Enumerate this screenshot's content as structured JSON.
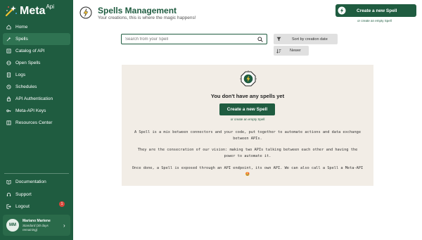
{
  "app": {
    "logo_text": "Meta",
    "logo_sup": "Api"
  },
  "sidebar": {
    "items": [
      {
        "label": "Home",
        "icon": "home-icon"
      },
      {
        "label": "Spells",
        "icon": "spell-icon",
        "active": true
      },
      {
        "label": "Catalog of API",
        "icon": "catalog-icon"
      },
      {
        "label": "Open Spells",
        "icon": "open-spells-icon"
      },
      {
        "label": "Logs",
        "icon": "logs-icon"
      },
      {
        "label": "Schedules",
        "icon": "clock-icon"
      },
      {
        "label": "API Authentication",
        "icon": "lock-icon"
      },
      {
        "label": "Meta-API Keys",
        "icon": "key-icon"
      },
      {
        "label": "Resources Center",
        "icon": "book-icon"
      }
    ],
    "bottom_items": [
      {
        "label": "Documentation",
        "icon": "documentation-icon"
      },
      {
        "label": "Support",
        "icon": "support-icon"
      },
      {
        "label": "Logout",
        "icon": "logout-icon"
      }
    ],
    "notification_count": "1",
    "user": {
      "initials": "MM",
      "name": "Mariano Martene",
      "plan": "Standard (30 days remaining)"
    }
  },
  "header": {
    "title": "Spells Management",
    "subtitle": "Your creations, this is where the magic happens!",
    "create_button": "Create a new Spell",
    "empty_link": "or create an empty Spell"
  },
  "toolbar": {
    "search_placeholder": "Search from your Spell",
    "sort_label": "Sort by creation date",
    "order_label": "Newer"
  },
  "empty_state": {
    "title": "You don't have any spells yet",
    "create_button": "Create a new Spell",
    "empty_link": "or create an empty Spell",
    "paragraphs": [
      "A Spell is a mix between connectors and your code, put together to automate actions and data exchange between APIs.",
      "They are the consecration of our vision: making two APIs talking between each other and having the power to automate it.",
      "Once done, a Spell is exposed through an API endpoint, its own API. We can also call a Spell a Meta-API 🤩"
    ]
  },
  "colors": {
    "primary": "#1f5c40",
    "panel_bg": "#f2ede6",
    "badge": "#d8473b"
  }
}
